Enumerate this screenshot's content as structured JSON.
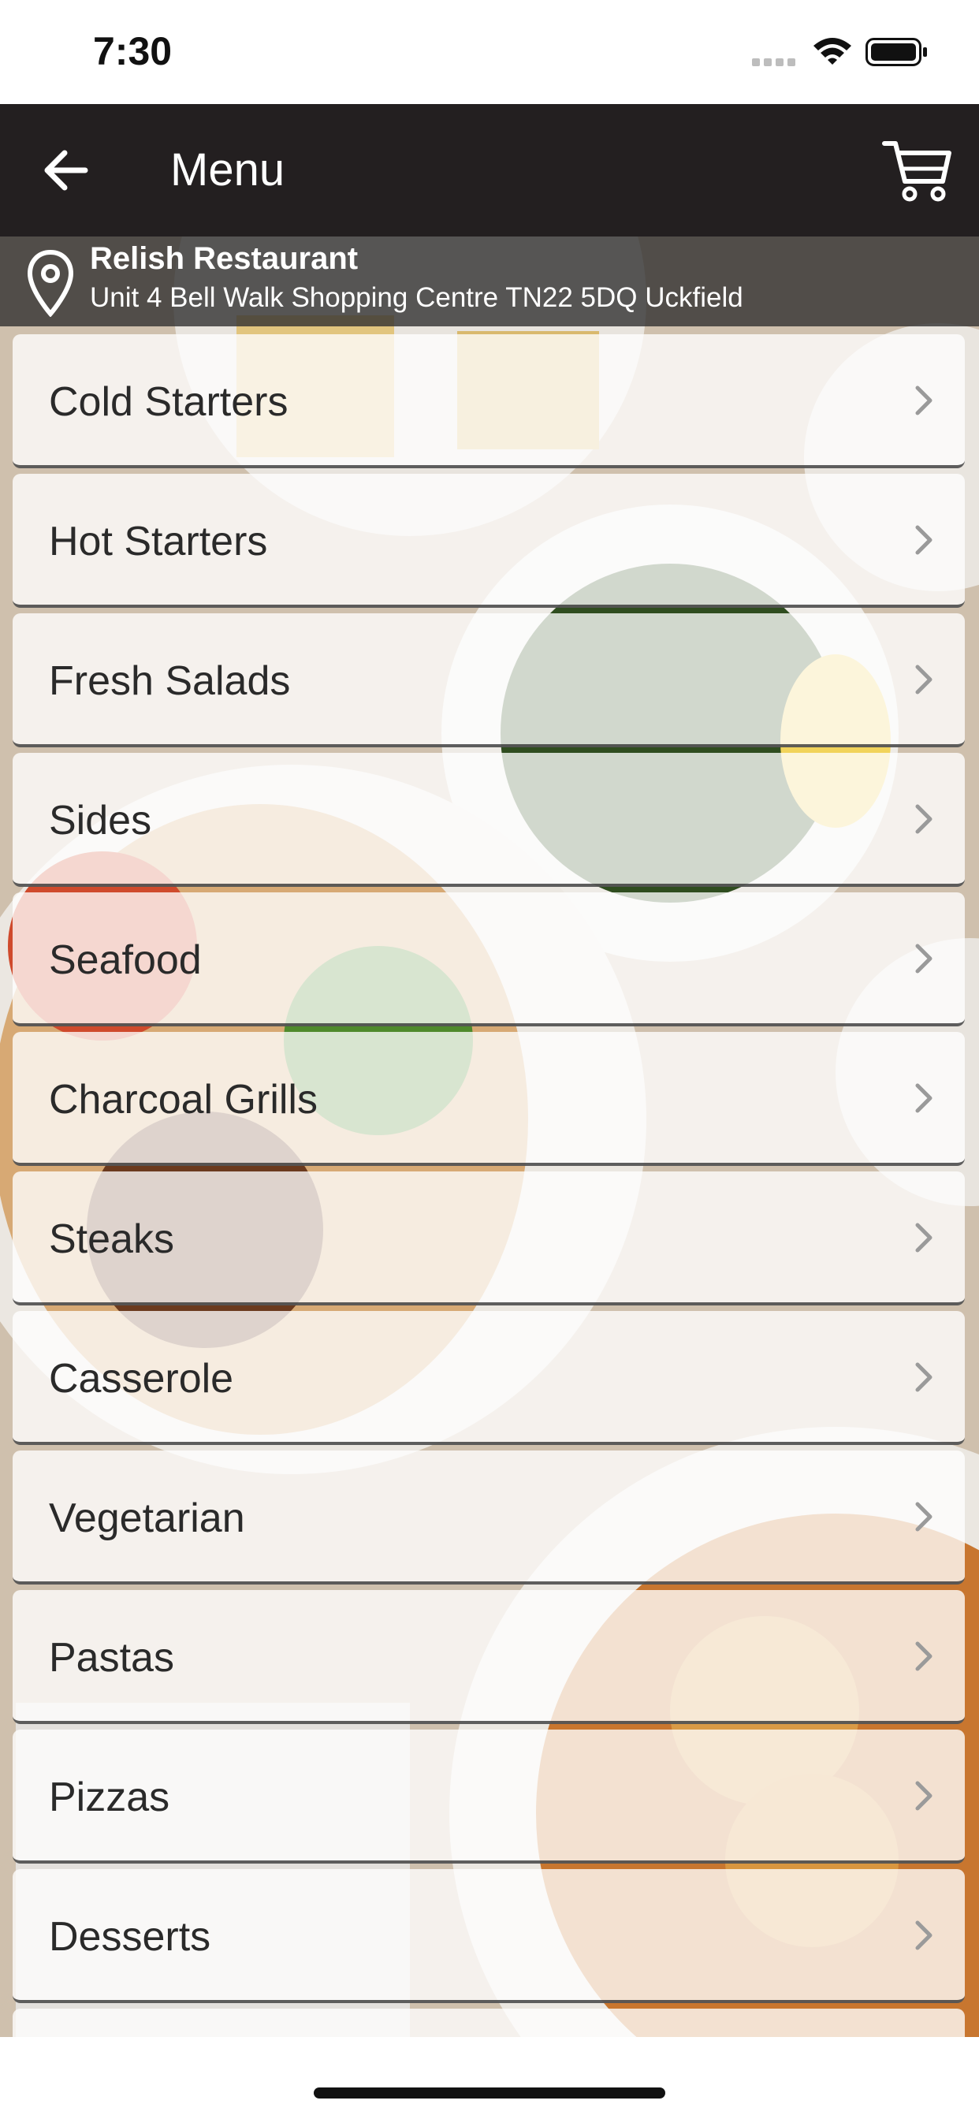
{
  "status_bar": {
    "time": "7:30"
  },
  "nav": {
    "title": "Menu"
  },
  "location": {
    "name": "Relish Restaurant",
    "address": "Unit 4 Bell Walk Shopping Centre TN22 5DQ Uckfield"
  },
  "menu": {
    "items": [
      {
        "label": "Cold Starters"
      },
      {
        "label": "Hot Starters"
      },
      {
        "label": "Fresh Salads"
      },
      {
        "label": "Sides"
      },
      {
        "label": "Seafood"
      },
      {
        "label": "Charcoal Grills"
      },
      {
        "label": "Steaks"
      },
      {
        "label": "Casserole"
      },
      {
        "label": "Vegetarian"
      },
      {
        "label": "Pastas"
      },
      {
        "label": "Pizzas"
      },
      {
        "label": "Desserts"
      },
      {
        "label": ""
      }
    ]
  },
  "colors": {
    "nav_background": "#231f20",
    "location_background": "#2d2d2d",
    "row_background": "#ffffff"
  }
}
